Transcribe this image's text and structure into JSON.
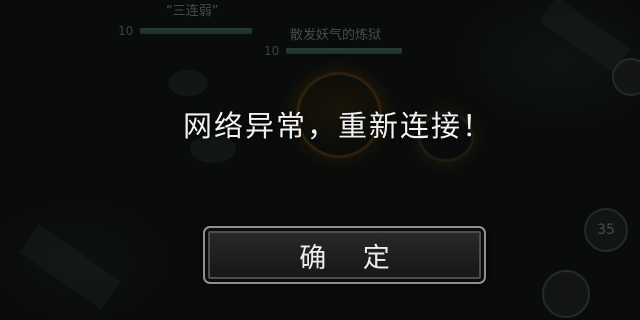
{
  "dialog": {
    "message": "网络异常，重新连接！",
    "confirm_label": "确 定"
  },
  "background_hud": {
    "player_name": "“三连弱”",
    "player_level": "10",
    "enemy_name": "散发妖气的炼狱",
    "enemy_level": "10",
    "skill_button_number": "35",
    "player_health_fraction": 1.0,
    "enemy_health_fraction": 1.0
  },
  "colors": {
    "dialog_text": "#f2f2f2",
    "button_border": "#8f8f8f",
    "health_bar": "#3c5e52"
  }
}
